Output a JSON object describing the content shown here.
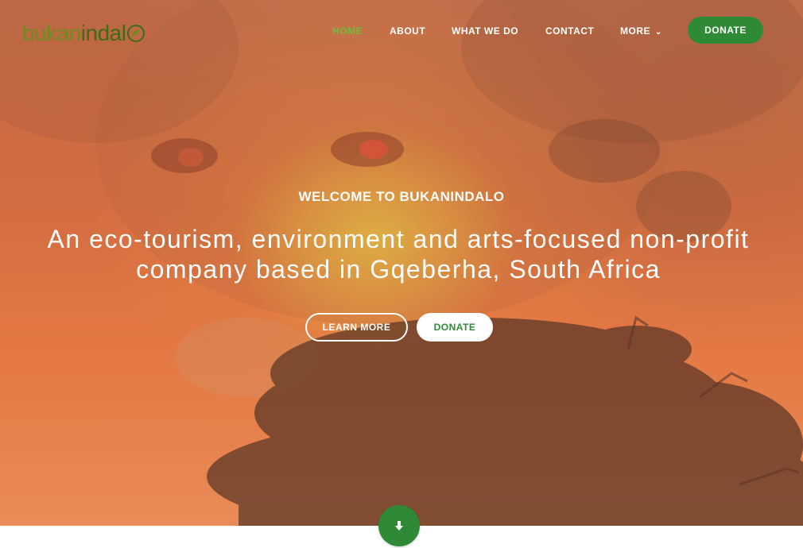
{
  "brand": {
    "logo_part1": "bukan",
    "logo_part2": "indal",
    "logo_leaf_icon": "leaf-o-icon",
    "colors": {
      "green_dark": "#2f8a37",
      "green_light": "#6fbf3a",
      "logo_olive": "#6d8b1f"
    }
  },
  "nav": {
    "items": [
      {
        "label": "HOME",
        "active": true
      },
      {
        "label": "ABOUT"
      },
      {
        "label": "WHAT WE DO"
      },
      {
        "label": "CONTACT"
      },
      {
        "label": "MORE",
        "icon": "chevron-down-icon"
      }
    ],
    "donate_label": "DONATE"
  },
  "hero": {
    "kicker": "WELCOME TO BUKANINDALO",
    "headline_line1": "An eco-tourism, environment and arts-focused non-profit",
    "headline_line2": "company based in Gqeberha, South Africa",
    "learn_more_label": "LEARN MORE",
    "donate_label": "DONATE",
    "scroll_icon": "arrow-down-icon"
  }
}
